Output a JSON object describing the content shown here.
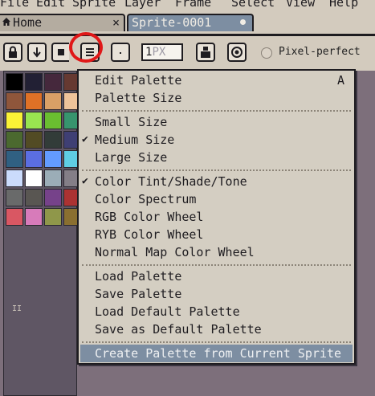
{
  "menubar": {
    "items": [
      "File",
      "Edit",
      "Sprite",
      "Layer",
      "Frame",
      "Select",
      "View",
      "Help"
    ]
  },
  "tabs": {
    "home": "Home",
    "home_close": "×",
    "sprite": "Sprite-0001"
  },
  "toolbar": {
    "lock_icon": "lock-icon",
    "down_icon": "arrow-down-icon",
    "square_icon": "square-icon",
    "options_icon": "hamburger-icon",
    "brush_size_prefix": "1",
    "brush_size_unit": "PX",
    "pixel_perfect_label": "Pixel-perfect"
  },
  "palette": {
    "colors": [
      "#000000",
      "#222034",
      "#45283c",
      "#663931",
      "#8f563b",
      "#df7126",
      "#d9a066",
      "#eec39a",
      "#fbf236",
      "#99e550",
      "#6abe30",
      "#37946e",
      "#4b692f",
      "#524b24",
      "#323c39",
      "#3f3f74",
      "#306082",
      "#5b6ee1",
      "#639bff",
      "#5fcde4",
      "#cbdbfc",
      "#ffffff",
      "#9badb7",
      "#847e87",
      "#696a6a",
      "#595652",
      "#76428a",
      "#ac3232",
      "#d95763",
      "#d77bba",
      "#8f974a",
      "#8a6f30"
    ]
  },
  "menu": {
    "items": [
      {
        "label": "Edit Palette",
        "shortcut": "A",
        "checked": false
      },
      {
        "label": "Palette Size",
        "shortcut": "",
        "checked": false
      },
      {
        "label": "Small Size",
        "shortcut": "",
        "checked": false
      },
      {
        "label": "Medium Size",
        "shortcut": "",
        "checked": true
      },
      {
        "label": "Large Size",
        "shortcut": "",
        "checked": false
      },
      {
        "label": "Color Tint/Shade/Tone",
        "shortcut": "",
        "checked": true
      },
      {
        "label": "Color Spectrum",
        "shortcut": "",
        "checked": false
      },
      {
        "label": "RGB Color Wheel",
        "shortcut": "",
        "checked": false
      },
      {
        "label": "RYB Color Wheel",
        "shortcut": "",
        "checked": false
      },
      {
        "label": "Normal Map Color Wheel",
        "shortcut": "",
        "checked": false
      },
      {
        "label": "Load Palette",
        "shortcut": "",
        "checked": false
      },
      {
        "label": "Save Palette",
        "shortcut": "",
        "checked": false
      },
      {
        "label": "Load Default Palette",
        "shortcut": "",
        "checked": false
      },
      {
        "label": "Save as Default Palette",
        "shortcut": "",
        "checked": false
      },
      {
        "label": "Create Palette from Current Sprite",
        "shortcut": "",
        "checked": false,
        "highlighted": true
      }
    ],
    "check_glyph": "✔"
  },
  "colors": {
    "highlight": "#7d8ea2",
    "menu_bg": "#d4cec2",
    "workspace": "#7d6f7b",
    "annotation": "#e01818"
  }
}
